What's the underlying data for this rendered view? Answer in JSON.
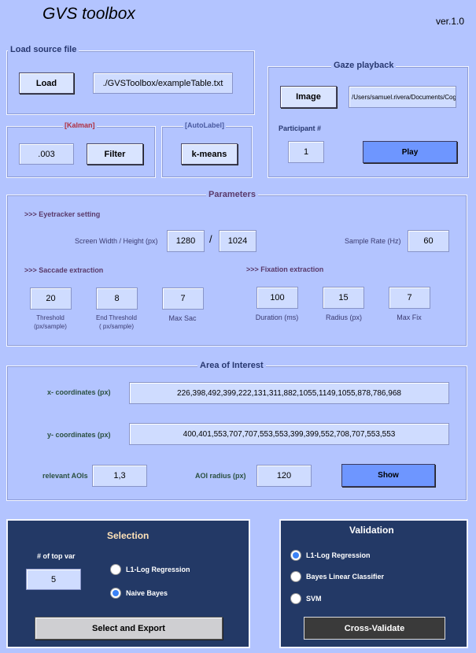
{
  "app": {
    "title": "GVS toolbox",
    "version": "ver.1.0"
  },
  "load_panel": {
    "title": "Load source file",
    "load_label": "Load",
    "path": "./GVSToolbox/exampleTable.txt"
  },
  "kalman": {
    "title": "[Kalman]",
    "value": ".003",
    "filter_label": "Filter"
  },
  "autolabel": {
    "title": "[AutoLabel]",
    "kmeans_label": "k-means"
  },
  "gaze": {
    "title": "Gaze playback",
    "image_label": "Image",
    "image_path": "/Users/samuel.rivera/Documents/CogDev",
    "participant_label": "Participant #",
    "participant_value": "1",
    "play_label": "Play"
  },
  "parameters": {
    "title": "Parameters",
    "eyetracker_heading": ">>> Eyetracker setting",
    "screen_label": "Screen  Width / Height (px)",
    "width": "1280",
    "slash": "/",
    "height": "1024",
    "sample_rate_label": "Sample Rate (Hz)",
    "sample_rate": "60",
    "saccade_heading": ">>> Saccade extraction",
    "saccade_threshold": "20",
    "saccade_threshold_label": "Threshold\n(px/sample)",
    "end_threshold": "8",
    "end_threshold_label": "End Threshold\n( px/sample)",
    "max_sac": "7",
    "max_sac_label": "Max Sac",
    "fixation_heading": ">>> Fixation extraction",
    "duration": "100",
    "duration_label": "Duration (ms)",
    "radius": "15",
    "radius_label": "Radius (px)",
    "max_fix": "7",
    "max_fix_label": "Max Fix"
  },
  "aoi": {
    "title": "Area of Interest",
    "x_label": "x- coordinates (px)",
    "x_value": "226,398,492,399,222,131,311,882,1055,1149,1055,878,786,968",
    "y_label": "y- coordinates (px)",
    "y_value": "400,401,553,707,707,553,553,399,399,552,708,707,553,553",
    "relevant_label": "relevant AOIs",
    "relevant_value": "1,3",
    "radius_label": "AOI radius (px)",
    "radius_value": "120",
    "show_label": "Show"
  },
  "selection": {
    "title": "Selection",
    "top_var_label": "# of top var",
    "top_var_value": "5",
    "options": [
      {
        "label": "L1-Log Regression",
        "selected": false
      },
      {
        "label": "Naive Bayes",
        "selected": true
      }
    ],
    "export_label": "Select and Export"
  },
  "validation": {
    "title": "Validation",
    "options": [
      {
        "label": "L1-Log Regression",
        "selected": true
      },
      {
        "label": "Bayes Linear Classifier",
        "selected": false
      },
      {
        "label": "SVM",
        "selected": false
      }
    ],
    "cross_label": "Cross-Validate"
  }
}
